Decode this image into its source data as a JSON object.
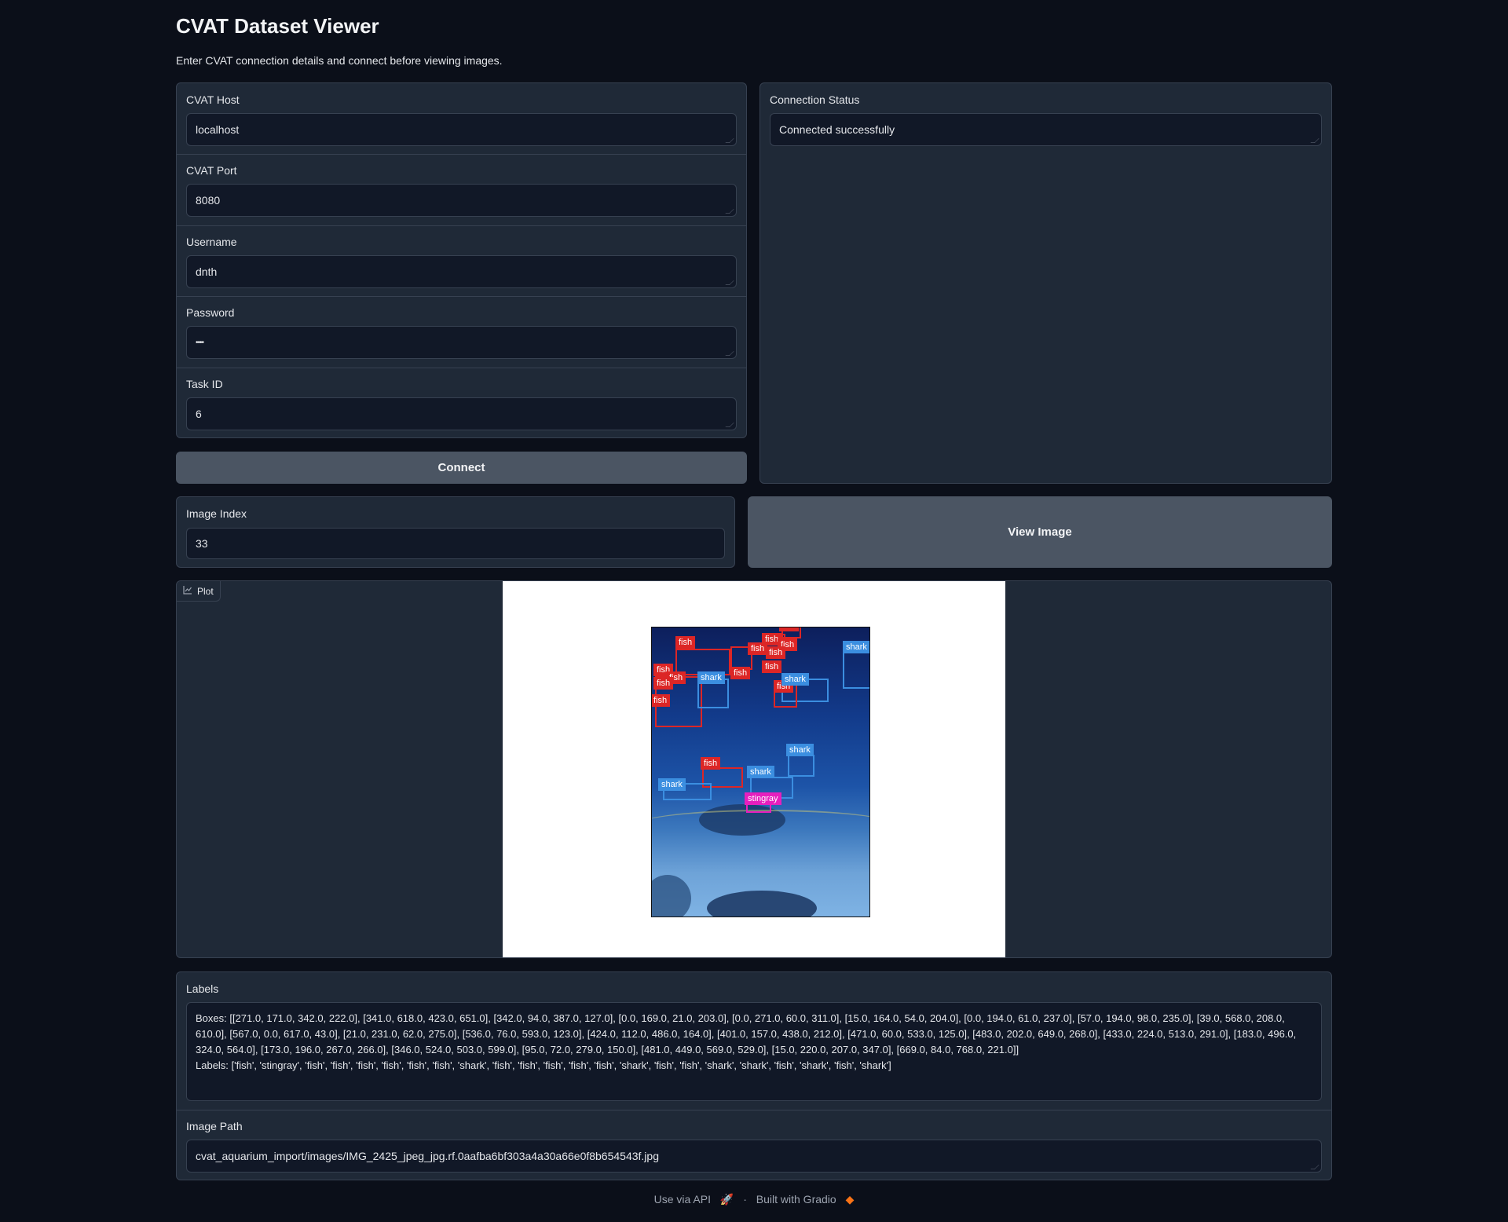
{
  "header": {
    "title": "CVAT Dataset Viewer",
    "subtitle": "Enter CVAT connection details and connect before viewing images."
  },
  "connection_form": {
    "host": {
      "label": "CVAT Host",
      "value": "localhost"
    },
    "port": {
      "label": "CVAT Port",
      "value": "8080"
    },
    "username": {
      "label": "Username",
      "value": "dnth"
    },
    "password": {
      "label": "Password",
      "value": "••••"
    },
    "task_id": {
      "label": "Task ID",
      "value": "6"
    },
    "connect_label": "Connect"
  },
  "status": {
    "label": "Connection Status",
    "value": "Connected successfully"
  },
  "image_index": {
    "label": "Image Index",
    "value": "33"
  },
  "view_button_label": "View Image",
  "plot": {
    "tag_label": "Plot",
    "annotations": [
      {
        "label": "fish",
        "color": "#dc2626"
      },
      {
        "label": "shark",
        "color": "#3b8ee0"
      },
      {
        "label": "stingray",
        "color": "#e61fbe"
      }
    ]
  },
  "labels_panel": {
    "label": "Labels",
    "text": "Boxes: [[271.0, 171.0, 342.0, 222.0], [341.0, 618.0, 423.0, 651.0], [342.0, 94.0, 387.0, 127.0], [0.0, 169.0, 21.0, 203.0], [0.0, 271.0, 60.0, 311.0], [15.0, 164.0, 54.0, 204.0], [0.0, 194.0, 61.0, 237.0], [57.0, 194.0, 98.0, 235.0], [39.0, 568.0, 208.0, 610.0], [567.0, 0.0, 617.0, 43.0], [21.0, 231.0, 62.0, 275.0], [536.0, 76.0, 593.0, 123.0], [424.0, 112.0, 486.0, 164.0], [401.0, 157.0, 438.0, 212.0], [471.0, 60.0, 533.0, 125.0], [483.0, 202.0, 649.0, 268.0], [433.0, 224.0, 513.0, 291.0], [183.0, 496.0, 324.0, 564.0], [173.0, 196.0, 267.0, 266.0], [346.0, 524.0, 503.0, 599.0], [95.0, 72.0, 279.0, 150.0], [481.0, 449.0, 569.0, 529.0], [15.0, 220.0, 207.0, 347.0], [669.0, 84.0, 768.0, 221.0]]\nLabels: ['fish', 'stingray', 'fish', 'fish', 'fish', 'fish', 'fish', 'fish', 'shark', 'fish', 'fish', 'fish', 'fish', 'fish', 'shark', 'fish', 'fish', 'shark', 'shark', 'fish', 'shark', 'fish', 'shark']"
  },
  "image_path": {
    "label": "Image Path",
    "value": "cvat_aquarium_import/images/IMG_2425_jpeg_jpg.rf.0aafba6bf303a4a30a66e0f8b654543f.jpg"
  },
  "footer": {
    "api_label": "Use via API",
    "separator": "·",
    "built_label": "Built with Gradio"
  }
}
